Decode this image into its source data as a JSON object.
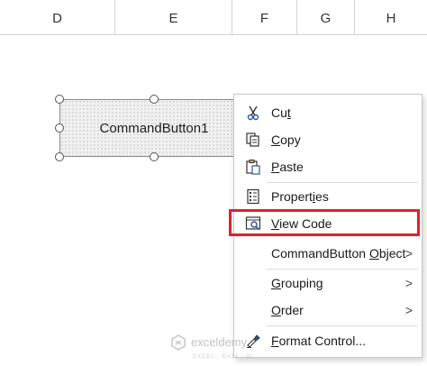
{
  "columns": [
    "D",
    "E",
    "F",
    "G",
    "H"
  ],
  "button": {
    "label": "CommandButton1"
  },
  "menu": {
    "cut": {
      "pre": "Cu",
      "key": "t",
      "post": ""
    },
    "copy": {
      "pre": "",
      "key": "C",
      "post": "opy"
    },
    "paste": {
      "pre": "",
      "key": "P",
      "post": "aste"
    },
    "properties": {
      "pre": "Propert",
      "key": "i",
      "post": "es"
    },
    "view_code": {
      "pre": "",
      "key": "V",
      "post": "iew Code"
    },
    "object": {
      "pre": "CommandButton ",
      "key": "O",
      "post": "bject"
    },
    "grouping": {
      "pre": "",
      "key": "G",
      "post": "rouping"
    },
    "order": {
      "pre": "",
      "key": "O",
      "post": "rder"
    },
    "format": {
      "pre": "",
      "key": "F",
      "post": "ormat Control..."
    }
  },
  "watermark": {
    "name": "exceldemy",
    "tagline": "EXCEL · DATA · BI"
  },
  "colors": {
    "highlight": "#e0202a",
    "icon_blue": "#2b579a"
  }
}
